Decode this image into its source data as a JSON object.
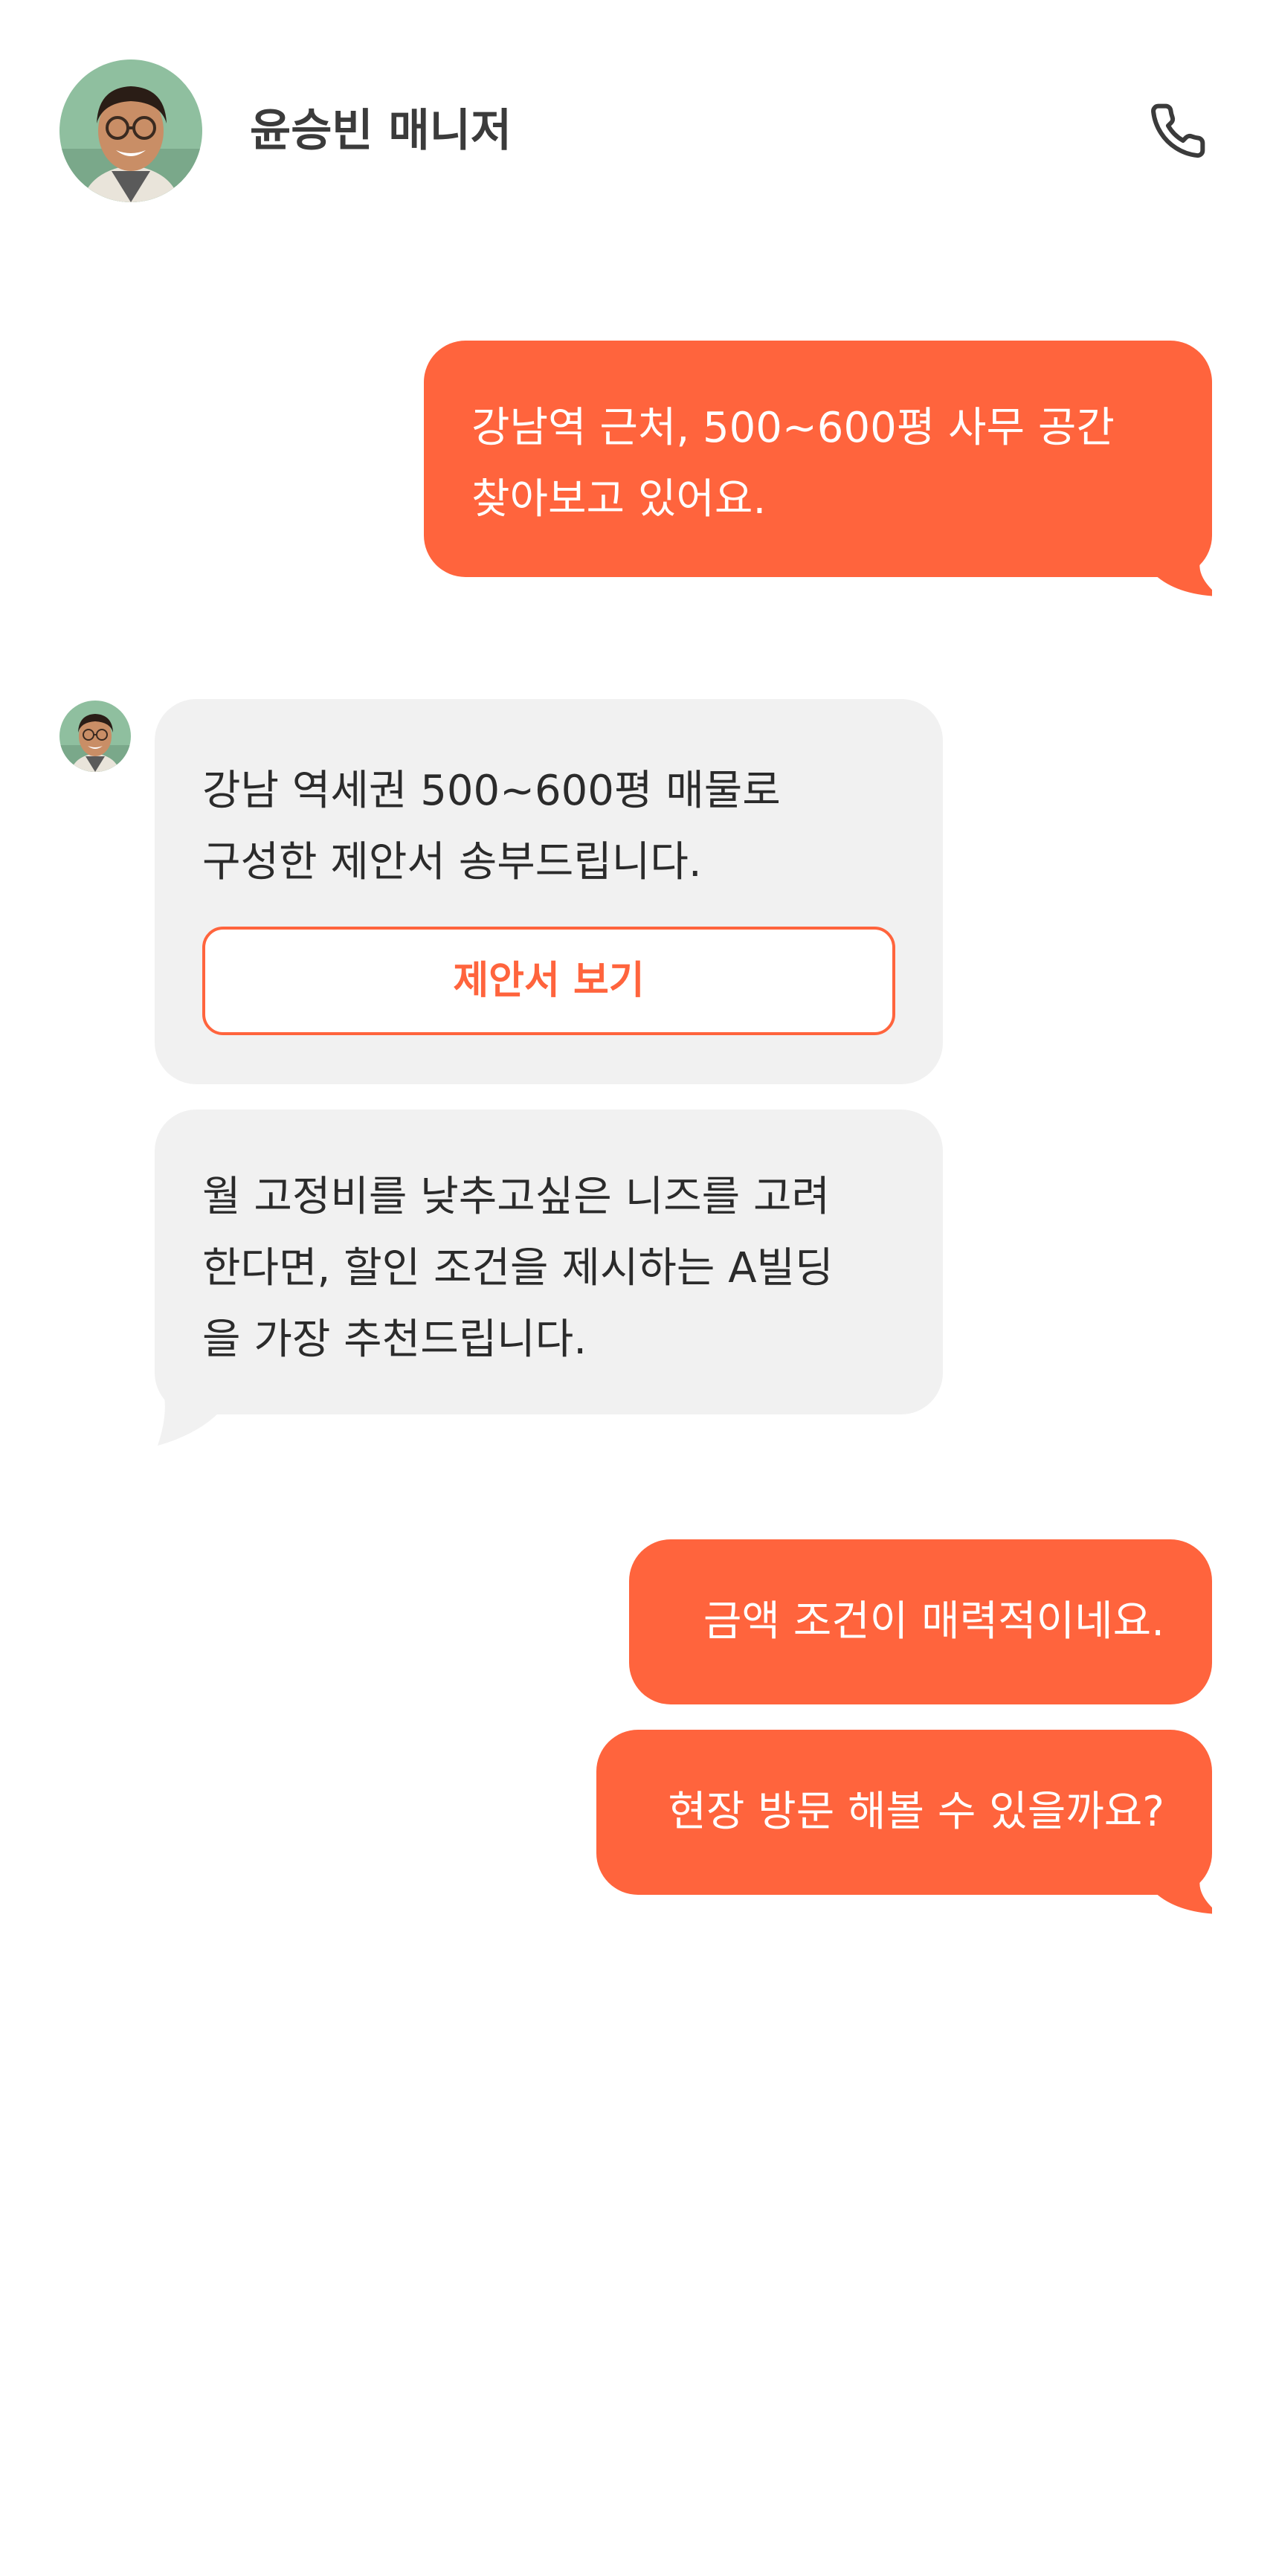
{
  "header": {
    "title": "윤승빈 매니저",
    "avatar_icon": "manager-portrait-avatar",
    "call_icon": "phone-icon"
  },
  "colors": {
    "accent": "#ff643d",
    "incoming_bubble": "#f1f1f1",
    "header_text": "#3b3b3b"
  },
  "messages": [
    {
      "sender": "me",
      "text": "강남역 근처, 500~600평 사무 공간\n찾아보고 있어요."
    },
    {
      "sender": "manager",
      "text": "강남 역세권 500~600평 매물로\n구성한 제안서 송부드립니다.",
      "button_label": "제안서 보기"
    },
    {
      "sender": "manager",
      "text": "월 고정비를 낮추고싶은 니즈를 고려\n한다면, 할인 조건을 제시하는 A빌딩\n을 가장 추천드립니다."
    },
    {
      "sender": "me",
      "text": "금액 조건이 매력적이네요."
    },
    {
      "sender": "me",
      "text": "현장 방문 해볼 수 있을까요?"
    }
  ]
}
